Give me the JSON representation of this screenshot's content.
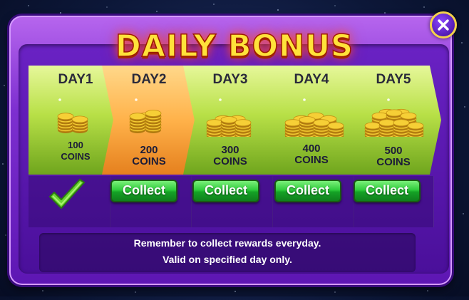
{
  "title": "DAILY BONUS",
  "close_icon": "close-icon",
  "days": [
    {
      "label": "DAY1",
      "amount": "100",
      "unit": "COINS",
      "state": "collected",
      "color": "#b8e047"
    },
    {
      "label": "DAY2",
      "amount": "200",
      "unit": "COINS",
      "state": "collectable",
      "color": "#ffb24a",
      "button": "Collect"
    },
    {
      "label": "DAY3",
      "amount": "300",
      "unit": "COINS",
      "state": "collectable",
      "color": "#b8e047",
      "button": "Collect"
    },
    {
      "label": "DAY4",
      "amount": "400",
      "unit": "COINS",
      "state": "collectable",
      "color": "#b8e047",
      "button": "Collect"
    },
    {
      "label": "DAY5",
      "amount": "500",
      "unit": "COINS",
      "state": "collectable",
      "color": "#b8e047",
      "button": "Collect"
    }
  ],
  "footer": {
    "line1": "Remember to collect rewards everyday.",
    "line2": "Valid on specified day only."
  },
  "colors": {
    "panel": "#7d2fd0",
    "title": "#ffe23a",
    "button": "#2fcc3c",
    "check": "#7ee34a"
  }
}
